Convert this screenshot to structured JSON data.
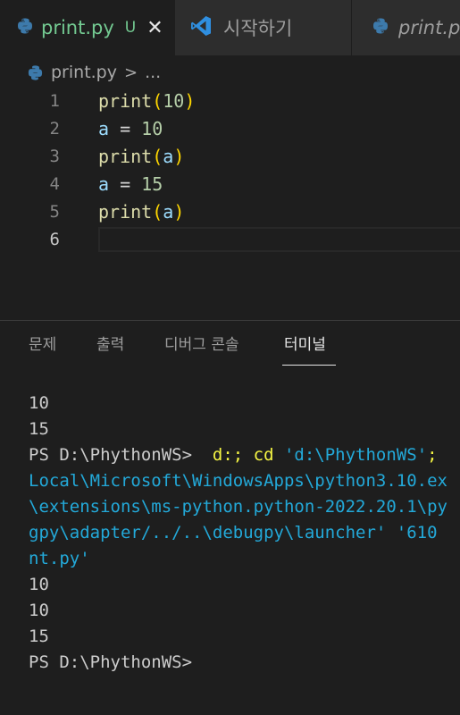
{
  "tabs": [
    {
      "label": "print.py",
      "status": "U",
      "close": "✕",
      "icon": "python-icon"
    },
    {
      "label": "시작하기",
      "icon": "vscode-icon"
    },
    {
      "label": "print.py",
      "icon": "python-icon"
    }
  ],
  "breadcrumb": {
    "file": "print.py",
    "separator": ">",
    "rest": "..."
  },
  "editor": {
    "lines": [
      {
        "num": "1",
        "tokens": [
          {
            "t": "print",
            "c": "fn"
          },
          {
            "t": "(",
            "c": "br"
          },
          {
            "t": "10",
            "c": "num"
          },
          {
            "t": ")",
            "c": "br"
          }
        ]
      },
      {
        "num": "2",
        "tokens": [
          {
            "t": "a",
            "c": "var"
          },
          {
            "t": " = ",
            "c": "op"
          },
          {
            "t": "10",
            "c": "num"
          }
        ]
      },
      {
        "num": "3",
        "tokens": [
          {
            "t": "print",
            "c": "fn"
          },
          {
            "t": "(",
            "c": "br"
          },
          {
            "t": "a",
            "c": "var"
          },
          {
            "t": ")",
            "c": "br"
          }
        ]
      },
      {
        "num": "4",
        "tokens": [
          {
            "t": "a",
            "c": "var"
          },
          {
            "t": " = ",
            "c": "op"
          },
          {
            "t": "15",
            "c": "num"
          }
        ]
      },
      {
        "num": "5",
        "tokens": [
          {
            "t": "print",
            "c": "fn"
          },
          {
            "t": "(",
            "c": "br"
          },
          {
            "t": "a",
            "c": "var"
          },
          {
            "t": ")",
            "c": "br"
          }
        ]
      },
      {
        "num": "6",
        "tokens": []
      }
    ]
  },
  "panel": {
    "tabs": [
      "문제",
      "출력",
      "디버그 콘솔",
      "터미널"
    ],
    "active": "터미널"
  },
  "terminal": {
    "lines": [
      [
        {
          "t": "10"
        }
      ],
      [
        {
          "t": "15"
        }
      ],
      [
        {
          "t": "PS D:\\PhythonWS>  "
        },
        {
          "t": "d:; cd ",
          "c": "cmd"
        },
        {
          "t": "'d:\\PhythonWS'",
          "c": "str"
        },
        {
          "t": "; ",
          "c": "cmd"
        }
      ],
      [
        {
          "t": "Local\\Microsoft\\WindowsApps\\python3.10.ex",
          "c": "strfull"
        }
      ],
      [
        {
          "t": "\\extensions\\ms-python.python-2022.20.1\\py",
          "c": "strfull"
        }
      ],
      [
        {
          "t": "gpy\\adapter/../..\\debugpy\\launcher' '610",
          "c": "strfull"
        }
      ],
      [
        {
          "t": "nt.py'",
          "c": "strfull"
        }
      ],
      [
        {
          "t": "10"
        }
      ],
      [
        {
          "t": "10"
        }
      ],
      [
        {
          "t": "15"
        }
      ],
      [
        {
          "t": "PS D:\\PhythonWS>"
        }
      ]
    ]
  },
  "colors": {
    "editor_bg": "#1e1e1e",
    "tabbar_bg": "#252526",
    "untracked": "#73c991",
    "function": "#dcdcaa",
    "bracket": "#ffd700",
    "number": "#b5cea8",
    "variable": "#9cdcfe",
    "terminal_cmd": "#f5f543",
    "terminal_str": "#23a9d9"
  }
}
